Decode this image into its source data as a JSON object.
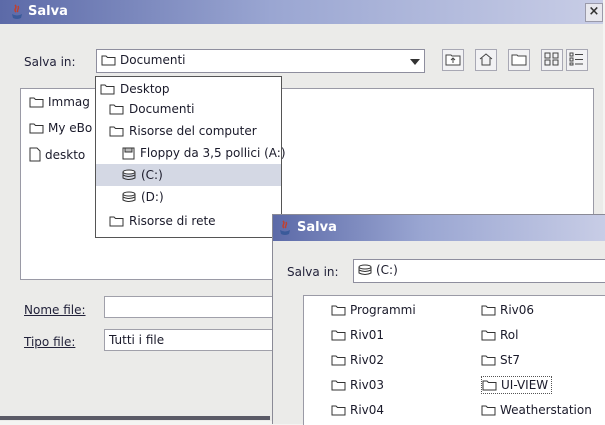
{
  "window1": {
    "title": "Salva",
    "close_label": "×",
    "save_in_label": "Salva in:",
    "save_in_value": "Documenti",
    "files": [
      {
        "name": "Immag",
        "type": "folder"
      },
      {
        "name": "My eBo",
        "type": "folder"
      },
      {
        "name": "deskto",
        "type": "file"
      }
    ],
    "filename_label": "Nome file:",
    "filename_value": "",
    "filetype_label": "Tipo file:",
    "filetype_value": "Tutti i file"
  },
  "dropdown": {
    "items": [
      {
        "label": "Desktop",
        "icon": "folder-icon",
        "level": 0
      },
      {
        "label": "Documenti",
        "icon": "folder-icon",
        "level": 1
      },
      {
        "label": "Risorse del computer",
        "icon": "folder-icon",
        "level": 1
      },
      {
        "label": "Floppy da 3,5 pollici (A:)",
        "icon": "floppy-icon",
        "level": 2
      },
      {
        "label": "(C:)",
        "icon": "disk-icon",
        "level": 2,
        "selected": true
      },
      {
        "label": "(D:)",
        "icon": "disk-icon",
        "level": 2
      },
      {
        "label": "Risorse di rete",
        "icon": "folder-icon",
        "level": 1
      }
    ]
  },
  "window2": {
    "title": "Salva",
    "save_in_label": "Salva in:",
    "save_in_value": "(C:)",
    "folders_left": [
      "Programmi",
      "Riv01",
      "Riv02",
      "Riv03",
      "Riv04"
    ],
    "folders_right": [
      "Riv06",
      "Rol",
      "St7",
      "UI-VIEW",
      "Weatherstation"
    ],
    "focused_folder": "UI-VIEW"
  }
}
